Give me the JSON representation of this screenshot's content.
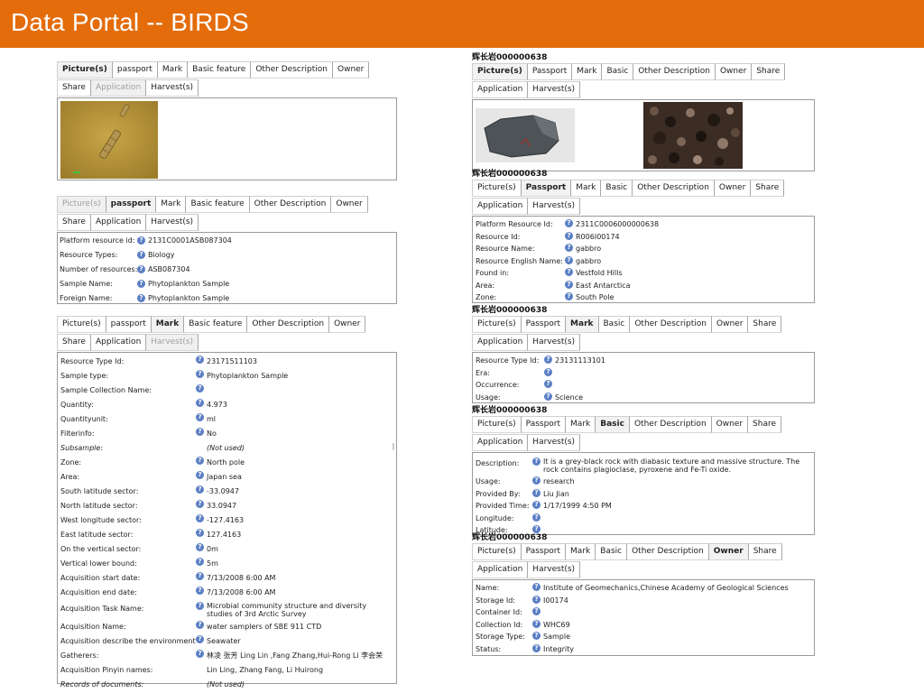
{
  "header": {
    "title": "Data Portal -- BIRDS"
  },
  "colors": {
    "header_bg": "#e46c0a",
    "header_text": "#ffffff",
    "help_icon": "#5b7fc4"
  },
  "icons": {
    "help": "help-question-icon"
  },
  "left": {
    "pictures_panel": {
      "tabs": [
        {
          "label": "Picture(s)",
          "state": "active"
        },
        {
          "label": "passport",
          "state": "normal"
        },
        {
          "label": "Mark",
          "state": "normal"
        },
        {
          "label": "Basic feature",
          "state": "normal"
        },
        {
          "label": "Other Description",
          "state": "normal"
        },
        {
          "label": "Owner",
          "state": "normal"
        },
        {
          "label": "Share",
          "state": "normal"
        },
        {
          "label": "Application",
          "state": "disabled"
        },
        {
          "label": "Harvest(s)",
          "state": "normal"
        }
      ]
    },
    "passport_panel": {
      "tabs": [
        {
          "label": "Picture(s)",
          "state": "disabled"
        },
        {
          "label": "passport",
          "state": "active"
        },
        {
          "label": "Mark",
          "state": "normal"
        },
        {
          "label": "Basic feature",
          "state": "normal"
        },
        {
          "label": "Other Description",
          "state": "normal"
        },
        {
          "label": "Owner",
          "state": "normal"
        },
        {
          "label": "Share",
          "state": "normal"
        },
        {
          "label": "Application",
          "state": "normal"
        },
        {
          "label": "Harvest(s)",
          "state": "normal"
        }
      ],
      "fields": [
        {
          "label": "Platform resource id:",
          "value": "2131C0001ASB087304"
        },
        {
          "label": "Resource Types:",
          "value": "Biology"
        },
        {
          "label": "Number of resources:",
          "value": "ASB087304"
        },
        {
          "label": "Sample Name:",
          "value": "Phytoplankton Sample"
        },
        {
          "label": "Foreign Name:",
          "value": "Phytoplankton Sample"
        }
      ]
    },
    "mark_panel": {
      "tabs": [
        {
          "label": "Picture(s)",
          "state": "normal"
        },
        {
          "label": "passport",
          "state": "normal"
        },
        {
          "label": "Mark",
          "state": "active"
        },
        {
          "label": "Basic feature",
          "state": "normal"
        },
        {
          "label": "Other Description",
          "state": "normal"
        },
        {
          "label": "Owner",
          "state": "normal"
        },
        {
          "label": "Share",
          "state": "normal"
        },
        {
          "label": "Application",
          "state": "normal"
        },
        {
          "label": "Harvest(s)",
          "state": "disabled"
        }
      ],
      "fields": [
        {
          "label": "Resource Type Id:",
          "value": "23171511103",
          "icon": true
        },
        {
          "label": "Sample type:",
          "value": "Phytoplankton Sample",
          "icon": true
        },
        {
          "label": "Sample Collection Name:",
          "value": "",
          "icon": true
        },
        {
          "label": "Quantity:",
          "value": "4.973",
          "icon": true
        },
        {
          "label": "Quantityunit:",
          "value": "ml",
          "icon": true
        },
        {
          "label": "Filterinfo:",
          "value": "No",
          "icon": true
        },
        {
          "label": "Subsample:",
          "value": "(Not used)",
          "icon": false,
          "italic": true
        },
        {
          "label": "Zone:",
          "value": "North pole",
          "icon": true
        },
        {
          "label": "Area:",
          "value": "Japan sea",
          "icon": true
        },
        {
          "label": "South latitude sector:",
          "value": "-33.0947",
          "icon": true
        },
        {
          "label": "North latitude sector:",
          "value": "33.0947",
          "icon": true
        },
        {
          "label": "West longitude sector:",
          "value": "-127.4163",
          "icon": true
        },
        {
          "label": "East latitude sector:",
          "value": "127.4163",
          "icon": true
        },
        {
          "label": "On the vertical sector:",
          "value": "0m",
          "icon": true
        },
        {
          "label": "Vertical lower bound:",
          "value": "5m",
          "icon": true
        },
        {
          "label": "Acquisition start date:",
          "value": "7/13/2008 6:00 AM",
          "icon": true
        },
        {
          "label": "Acquisition end date:",
          "value": "7/13/2008 6:00 AM",
          "icon": true
        },
        {
          "label": "Acquisition Task Name:",
          "value": "Microbial community structure and diversity studies of 3rd Arctic Survey",
          "icon": true,
          "wrap": true
        },
        {
          "label": "Acquisition Name:",
          "value": "water samplers of SBE 911 CTD",
          "icon": true
        },
        {
          "label": "Acquisition describe the environment:",
          "value": "Seawater",
          "icon": true
        },
        {
          "label": "Gatherers:",
          "value": "林凌 张芳  Ling Lin ,Fang Zhang,Hui-Rong Li 李会荣",
          "icon": true
        },
        {
          "label": "Acquisition Pinyin names:",
          "value": "Lin Ling, Zhang Fang, Li Huirong",
          "icon": false
        },
        {
          "label": "Records of documents:",
          "value": "(Not used)",
          "icon": false,
          "italic": true
        }
      ]
    }
  },
  "right": {
    "panel1": {
      "heading": "辉长岩000000638",
      "tabs": [
        {
          "label": "Picture(s)",
          "state": "active"
        },
        {
          "label": "Passport",
          "state": "normal"
        },
        {
          "label": "Mark",
          "state": "normal"
        },
        {
          "label": "Basic",
          "state": "normal"
        },
        {
          "label": "Other Description",
          "state": "normal"
        },
        {
          "label": "Owner",
          "state": "normal"
        },
        {
          "label": "Share",
          "state": "normal"
        },
        {
          "label": "Application",
          "state": "normal"
        },
        {
          "label": "Harvest(s)",
          "state": "normal"
        }
      ]
    },
    "panel2": {
      "heading": "辉长岩000000638",
      "tabs": [
        {
          "label": "Picture(s)",
          "state": "normal"
        },
        {
          "label": "Passport",
          "state": "active"
        },
        {
          "label": "Mark",
          "state": "normal"
        },
        {
          "label": "Basic",
          "state": "normal"
        },
        {
          "label": "Other Description",
          "state": "normal"
        },
        {
          "label": "Owner",
          "state": "normal"
        },
        {
          "label": "Share",
          "state": "normal"
        },
        {
          "label": "Application",
          "state": "normal"
        },
        {
          "label": "Harvest(s)",
          "state": "normal"
        }
      ],
      "fields": [
        {
          "label": "Platform Resource Id:",
          "value": "2311C0006000000638",
          "icon": true
        },
        {
          "label": "Resource Id:",
          "value": "R006I00174",
          "icon": true
        },
        {
          "label": "Resource Name:",
          "value": "gabbro",
          "icon": true
        },
        {
          "label": "Resource English Name:",
          "value": "gabbro",
          "icon": true
        },
        {
          "label": "Found in:",
          "value": "Vestfold Hills",
          "icon": true
        },
        {
          "label": "Area:",
          "value": "East Antarctica",
          "icon": true
        },
        {
          "label": "Zone:",
          "value": "South Pole",
          "icon": true
        }
      ]
    },
    "panel3": {
      "heading": "辉长岩000000638",
      "tabs": [
        {
          "label": "Picture(s)",
          "state": "normal"
        },
        {
          "label": "Passport",
          "state": "normal"
        },
        {
          "label": "Mark",
          "state": "active"
        },
        {
          "label": "Basic",
          "state": "normal"
        },
        {
          "label": "Other Description",
          "state": "normal"
        },
        {
          "label": "Owner",
          "state": "normal"
        },
        {
          "label": "Share",
          "state": "normal"
        },
        {
          "label": "Application",
          "state": "normal"
        },
        {
          "label": "Harvest(s)",
          "state": "normal"
        }
      ],
      "fields": [
        {
          "label": "Resource Type Id:",
          "value": "23131113101",
          "icon": true
        },
        {
          "label": "Era:",
          "value": "",
          "icon": true
        },
        {
          "label": "Occurrence:",
          "value": "",
          "icon": true
        },
        {
          "label": "Usage:",
          "value": "Science",
          "icon": true
        }
      ]
    },
    "panel4": {
      "heading": "辉长岩000000638",
      "tabs": [
        {
          "label": "Picture(s)",
          "state": "normal"
        },
        {
          "label": "Passport",
          "state": "normal"
        },
        {
          "label": "Mark",
          "state": "normal"
        },
        {
          "label": "Basic",
          "state": "active"
        },
        {
          "label": "Other Description",
          "state": "normal"
        },
        {
          "label": "Owner",
          "state": "normal"
        },
        {
          "label": "Share",
          "state": "normal"
        },
        {
          "label": "Application",
          "state": "normal"
        },
        {
          "label": "Harvest(s)",
          "state": "normal"
        }
      ],
      "fields": [
        {
          "label": "Description:",
          "value": "It is a grey-black rock with diabasic texture and massive structure. The rock contains plagioclase, pyroxene and Fe-Ti oxide.",
          "icon": true,
          "wrap": true
        },
        {
          "label": "Usage:",
          "value": "research",
          "icon": true
        },
        {
          "label": "Provided By:",
          "value": "Liu Jian",
          "icon": true
        },
        {
          "label": "Provided Time:",
          "value": "1/17/1999 4:50 PM",
          "icon": true
        },
        {
          "label": "Longitude:",
          "value": "",
          "icon": true
        },
        {
          "label": "Latitude:",
          "value": "",
          "icon": true
        }
      ]
    },
    "panel5": {
      "heading": "辉长岩000000638",
      "tabs": [
        {
          "label": "Picture(s)",
          "state": "normal"
        },
        {
          "label": "Passport",
          "state": "normal"
        },
        {
          "label": "Mark",
          "state": "normal"
        },
        {
          "label": "Basic",
          "state": "normal"
        },
        {
          "label": "Other Description",
          "state": "normal"
        },
        {
          "label": "Owner",
          "state": "active"
        },
        {
          "label": "Share",
          "state": "normal"
        },
        {
          "label": "Application",
          "state": "normal"
        },
        {
          "label": "Harvest(s)",
          "state": "normal"
        }
      ],
      "fields": [
        {
          "label": "Name:",
          "value": "Institute of Geomechanics,Chinese Academy of Geological Sciences",
          "icon": true
        },
        {
          "label": "Storage Id:",
          "value": "I00174",
          "icon": true
        },
        {
          "label": "Container Id:",
          "value": "",
          "icon": true
        },
        {
          "label": "Collection Id:",
          "value": "WHC69",
          "icon": true
        },
        {
          "label": "Storage Type:",
          "value": "Sample",
          "icon": true
        },
        {
          "label": "Status:",
          "value": "Integrity",
          "icon": true
        }
      ]
    }
  }
}
